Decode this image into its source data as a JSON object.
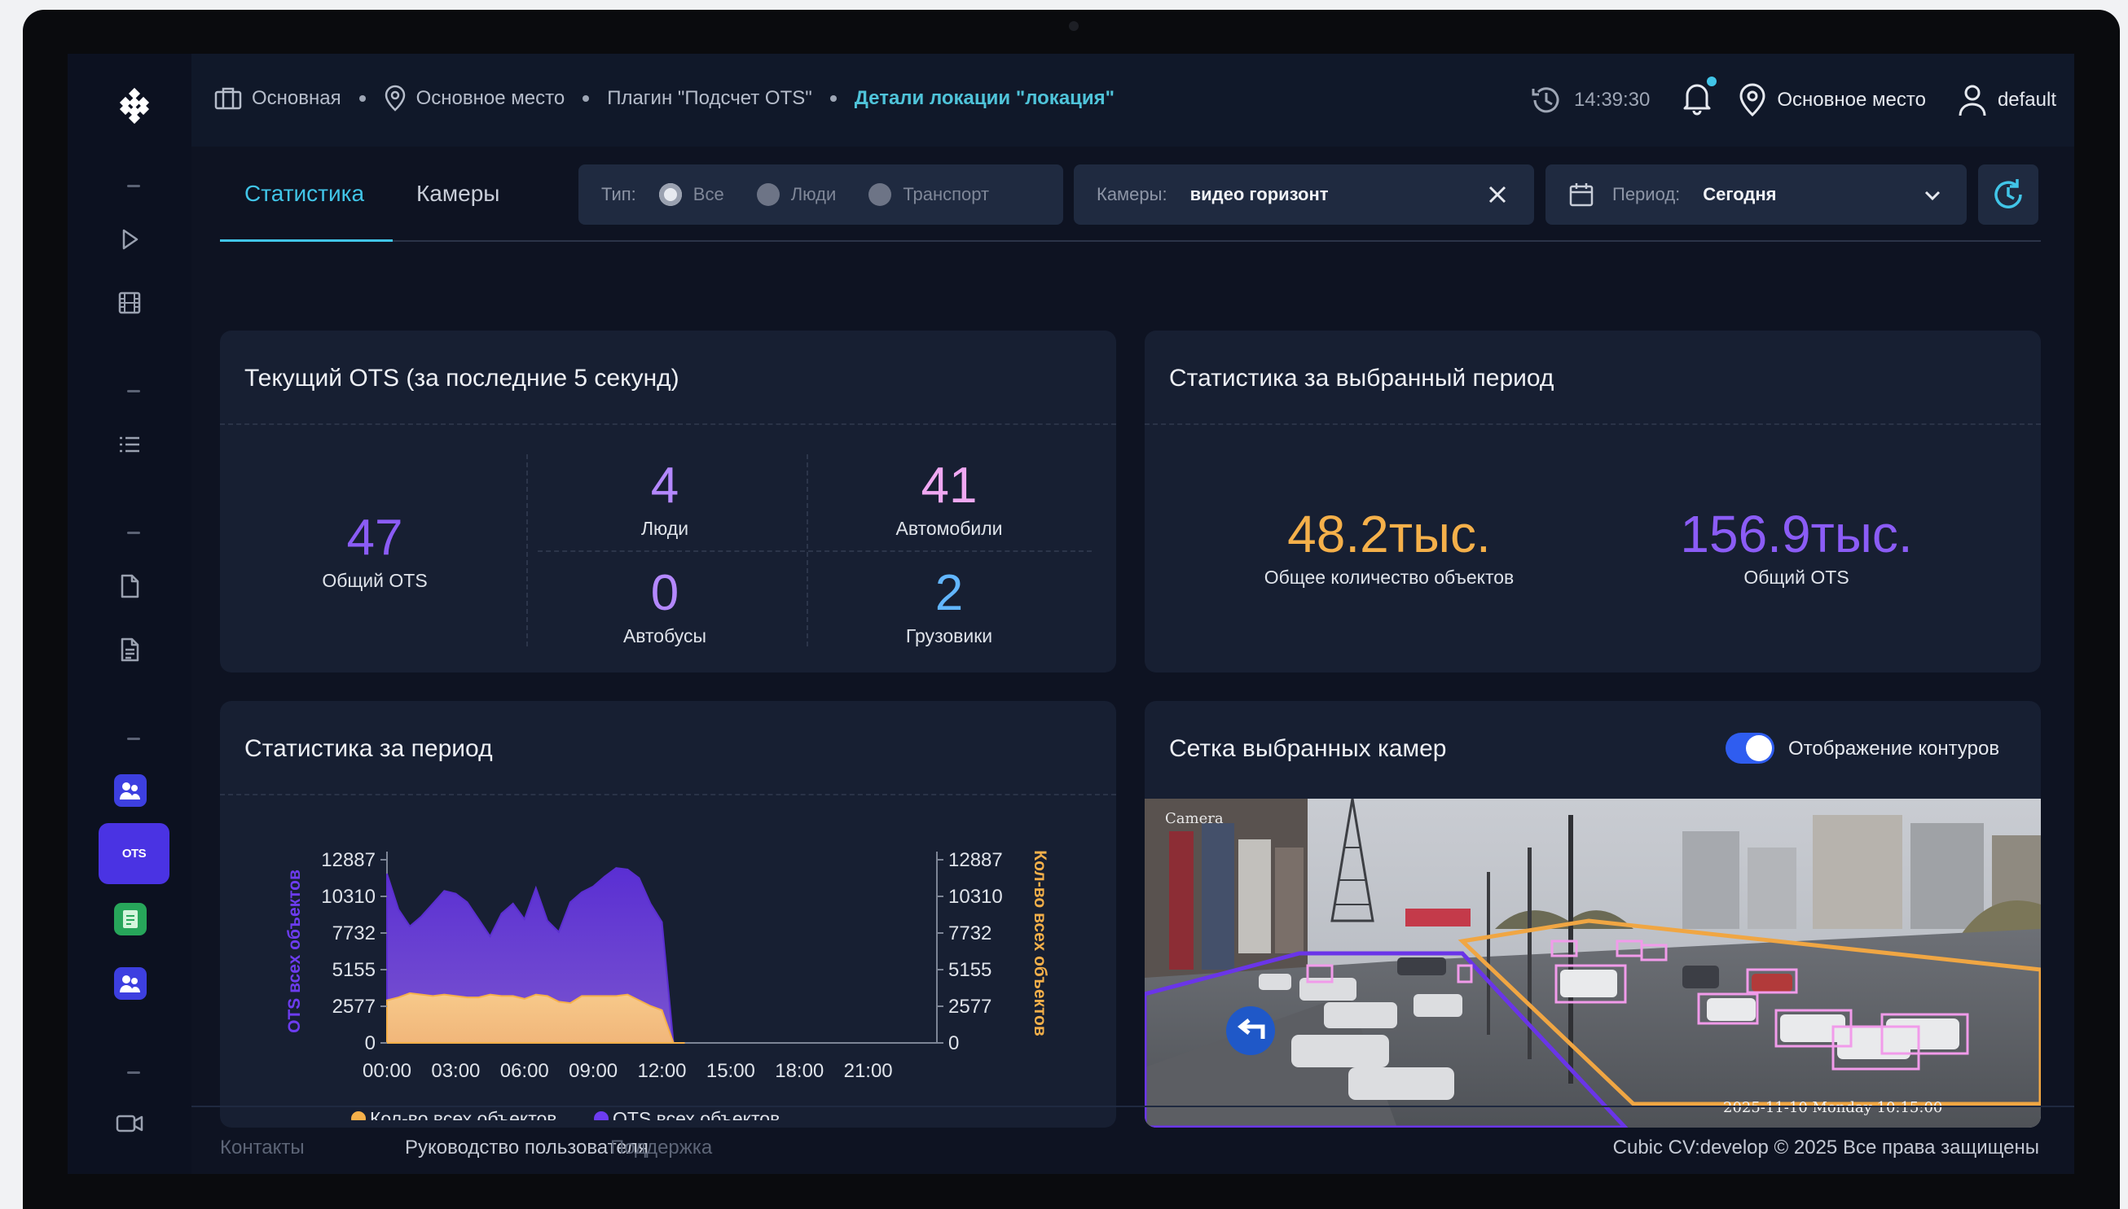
{
  "breadcrumb": {
    "items": [
      "Основная",
      "Основное место",
      "Плагин \"Подсчет OTS\"",
      "Детали локации \"локация\""
    ]
  },
  "topbar": {
    "time": "14:39:30",
    "location": "Основное место",
    "user": "default"
  },
  "tabs": [
    "Статистика",
    "Камеры"
  ],
  "filters": {
    "type_label": "Тип:",
    "type_options": [
      "Все",
      "Люди",
      "Транспорт"
    ],
    "type_selected": "Все",
    "cameras_label": "Камеры:",
    "cameras_value": "видео горизонт",
    "period_label": "Период:",
    "period_value": "Сегодня"
  },
  "current_ots": {
    "title": "Текущий OTS (за последние 5 секунд)",
    "total_value": "47",
    "total_label": "Общий OTS",
    "people_value": "4",
    "people_label": "Люди",
    "cars_value": "41",
    "cars_label": "Автомобили",
    "buses_value": "0",
    "buses_label": "Автобусы",
    "trucks_value": "2",
    "trucks_label": "Грузовики"
  },
  "period_stats": {
    "title": "Статистика за выбранный период",
    "objects_value": "48.2тыс.",
    "objects_label": "Общее количество объектов",
    "ots_value": "156.9тыс.",
    "ots_label": "Общий OTS"
  },
  "chart_card": {
    "title": "Статистика за период"
  },
  "chart_data": {
    "type": "area",
    "title": "",
    "x": [
      "00:00",
      "00:30",
      "01:00",
      "01:30",
      "02:00",
      "02:30",
      "03:00",
      "03:30",
      "04:00",
      "04:30",
      "05:00",
      "05:30",
      "06:00",
      "06:30",
      "07:00",
      "07:30",
      "08:00",
      "08:30",
      "09:00",
      "09:30",
      "10:00",
      "10:30",
      "11:00",
      "11:30",
      "12:00",
      "12:30",
      "13:00"
    ],
    "x_ticks": [
      "00:00",
      "03:00",
      "06:00",
      "09:00",
      "12:00",
      "15:00",
      "18:00",
      "21:00"
    ],
    "y_ticks": [
      "0",
      "2577",
      "5155",
      "7732",
      "10310",
      "12887"
    ],
    "ylim": [
      0,
      12887
    ],
    "ylabel": "OTS всех объектов",
    "ylabel_right": "Кол-во всех объектов",
    "series": [
      {
        "name": "OTS всех объектов",
        "color": "#5b2fd0",
        "values": [
          11900,
          9400,
          8200,
          8900,
          9800,
          10700,
          10500,
          9900,
          8700,
          7500,
          9100,
          9800,
          8700,
          10900,
          8600,
          7800,
          9900,
          10600,
          11000,
          11700,
          12300,
          12200,
          11600,
          9800,
          8500,
          0,
          0
        ]
      },
      {
        "name": "Кол-во всех объектов",
        "color": "#f5b04a",
        "values": [
          3000,
          3200,
          3500,
          3400,
          3300,
          3400,
          3300,
          3200,
          3200,
          3400,
          3300,
          3300,
          3100,
          3400,
          3300,
          2900,
          2800,
          3300,
          3300,
          3300,
          3300,
          3400,
          3000,
          2600,
          2300,
          0,
          0
        ]
      }
    ],
    "legend": [
      "Кол-во всех объектов",
      "OTS всех объектов"
    ],
    "legend_position": "bottom"
  },
  "camera_grid": {
    "title": "Сетка выбранных камер",
    "toggle_label": "Отображение контуров",
    "toggle_on": true,
    "cam_name": "Camera",
    "timestamp": "2025-11-10 Monday 10:15:00"
  },
  "footer": {
    "contacts": "Контакты",
    "guide": "Руководство пользователя",
    "support": "Поддержка",
    "copyright": "Cubic CV:develop © 2025 Все права защищены"
  }
}
